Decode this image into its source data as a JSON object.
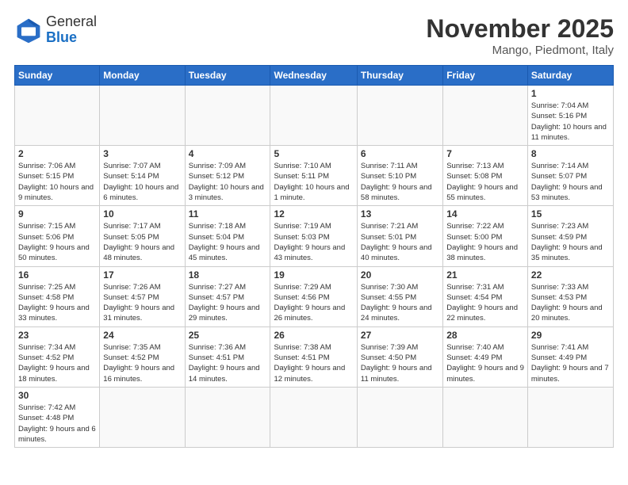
{
  "header": {
    "logo_general": "General",
    "logo_blue": "Blue",
    "month_title": "November 2025",
    "location": "Mango, Piedmont, Italy"
  },
  "weekdays": [
    "Sunday",
    "Monday",
    "Tuesday",
    "Wednesday",
    "Thursday",
    "Friday",
    "Saturday"
  ],
  "weeks": [
    [
      {
        "day": "",
        "info": ""
      },
      {
        "day": "",
        "info": ""
      },
      {
        "day": "",
        "info": ""
      },
      {
        "day": "",
        "info": ""
      },
      {
        "day": "",
        "info": ""
      },
      {
        "day": "",
        "info": ""
      },
      {
        "day": "1",
        "info": "Sunrise: 7:04 AM\nSunset: 5:16 PM\nDaylight: 10 hours and 11 minutes."
      }
    ],
    [
      {
        "day": "2",
        "info": "Sunrise: 7:06 AM\nSunset: 5:15 PM\nDaylight: 10 hours and 9 minutes."
      },
      {
        "day": "3",
        "info": "Sunrise: 7:07 AM\nSunset: 5:14 PM\nDaylight: 10 hours and 6 minutes."
      },
      {
        "day": "4",
        "info": "Sunrise: 7:09 AM\nSunset: 5:12 PM\nDaylight: 10 hours and 3 minutes."
      },
      {
        "day": "5",
        "info": "Sunrise: 7:10 AM\nSunset: 5:11 PM\nDaylight: 10 hours and 1 minute."
      },
      {
        "day": "6",
        "info": "Sunrise: 7:11 AM\nSunset: 5:10 PM\nDaylight: 9 hours and 58 minutes."
      },
      {
        "day": "7",
        "info": "Sunrise: 7:13 AM\nSunset: 5:08 PM\nDaylight: 9 hours and 55 minutes."
      },
      {
        "day": "8",
        "info": "Sunrise: 7:14 AM\nSunset: 5:07 PM\nDaylight: 9 hours and 53 minutes."
      }
    ],
    [
      {
        "day": "9",
        "info": "Sunrise: 7:15 AM\nSunset: 5:06 PM\nDaylight: 9 hours and 50 minutes."
      },
      {
        "day": "10",
        "info": "Sunrise: 7:17 AM\nSunset: 5:05 PM\nDaylight: 9 hours and 48 minutes."
      },
      {
        "day": "11",
        "info": "Sunrise: 7:18 AM\nSunset: 5:04 PM\nDaylight: 9 hours and 45 minutes."
      },
      {
        "day": "12",
        "info": "Sunrise: 7:19 AM\nSunset: 5:03 PM\nDaylight: 9 hours and 43 minutes."
      },
      {
        "day": "13",
        "info": "Sunrise: 7:21 AM\nSunset: 5:01 PM\nDaylight: 9 hours and 40 minutes."
      },
      {
        "day": "14",
        "info": "Sunrise: 7:22 AM\nSunset: 5:00 PM\nDaylight: 9 hours and 38 minutes."
      },
      {
        "day": "15",
        "info": "Sunrise: 7:23 AM\nSunset: 4:59 PM\nDaylight: 9 hours and 35 minutes."
      }
    ],
    [
      {
        "day": "16",
        "info": "Sunrise: 7:25 AM\nSunset: 4:58 PM\nDaylight: 9 hours and 33 minutes."
      },
      {
        "day": "17",
        "info": "Sunrise: 7:26 AM\nSunset: 4:57 PM\nDaylight: 9 hours and 31 minutes."
      },
      {
        "day": "18",
        "info": "Sunrise: 7:27 AM\nSunset: 4:57 PM\nDaylight: 9 hours and 29 minutes."
      },
      {
        "day": "19",
        "info": "Sunrise: 7:29 AM\nSunset: 4:56 PM\nDaylight: 9 hours and 26 minutes."
      },
      {
        "day": "20",
        "info": "Sunrise: 7:30 AM\nSunset: 4:55 PM\nDaylight: 9 hours and 24 minutes."
      },
      {
        "day": "21",
        "info": "Sunrise: 7:31 AM\nSunset: 4:54 PM\nDaylight: 9 hours and 22 minutes."
      },
      {
        "day": "22",
        "info": "Sunrise: 7:33 AM\nSunset: 4:53 PM\nDaylight: 9 hours and 20 minutes."
      }
    ],
    [
      {
        "day": "23",
        "info": "Sunrise: 7:34 AM\nSunset: 4:52 PM\nDaylight: 9 hours and 18 minutes."
      },
      {
        "day": "24",
        "info": "Sunrise: 7:35 AM\nSunset: 4:52 PM\nDaylight: 9 hours and 16 minutes."
      },
      {
        "day": "25",
        "info": "Sunrise: 7:36 AM\nSunset: 4:51 PM\nDaylight: 9 hours and 14 minutes."
      },
      {
        "day": "26",
        "info": "Sunrise: 7:38 AM\nSunset: 4:51 PM\nDaylight: 9 hours and 12 minutes."
      },
      {
        "day": "27",
        "info": "Sunrise: 7:39 AM\nSunset: 4:50 PM\nDaylight: 9 hours and 11 minutes."
      },
      {
        "day": "28",
        "info": "Sunrise: 7:40 AM\nSunset: 4:49 PM\nDaylight: 9 hours and 9 minutes."
      },
      {
        "day": "29",
        "info": "Sunrise: 7:41 AM\nSunset: 4:49 PM\nDaylight: 9 hours and 7 minutes."
      }
    ],
    [
      {
        "day": "30",
        "info": "Sunrise: 7:42 AM\nSunset: 4:48 PM\nDaylight: 9 hours and 6 minutes."
      },
      {
        "day": "",
        "info": ""
      },
      {
        "day": "",
        "info": ""
      },
      {
        "day": "",
        "info": ""
      },
      {
        "day": "",
        "info": ""
      },
      {
        "day": "",
        "info": ""
      },
      {
        "day": "",
        "info": ""
      }
    ]
  ]
}
